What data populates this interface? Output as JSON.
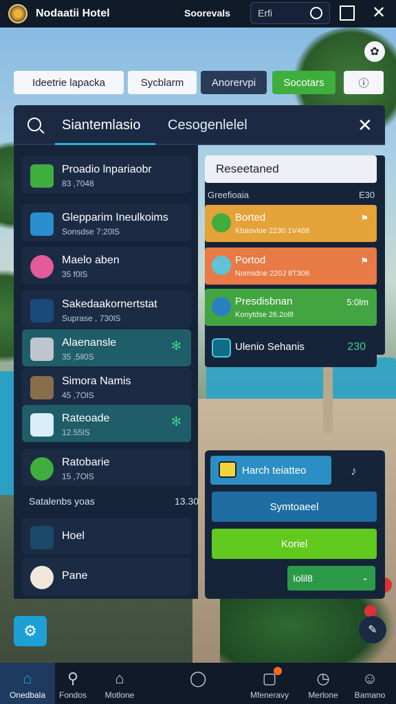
{
  "app": {
    "title": "Nodaatii Hotel",
    "top_link": "Soorevals",
    "search_value": "Erfi"
  },
  "chips": [
    "Ideetrie lapacka",
    "Sycblarm",
    "Anorervpi",
    "Socotars",
    "ⓘ"
  ],
  "panel": {
    "tab_1": "Siantemlasio",
    "tab_2": "Cesogenlelel"
  },
  "list": [
    {
      "title": "Proadio lnpariaobr",
      "sub": "83 ,7048"
    },
    {
      "title": "Glepparim Ineulkoims",
      "sub": "Sonsdse 7:20lS"
    },
    {
      "title": "Maelo aben",
      "sub": "35 f0lS"
    },
    {
      "title": "Sakedaakornertstat",
      "sub": "Suprase , 730lS"
    },
    {
      "title": "Alaenansle",
      "sub": "35 ,5ll0S"
    },
    {
      "title": "Simora Namis",
      "sub": "45 ,7OlS"
    },
    {
      "title": "Rateoade",
      "sub": "12.55lS"
    },
    {
      "title": "Ratobarie",
      "sub": "15 ,7OlS"
    },
    {
      "title": "Hoel",
      "sub": ""
    },
    {
      "title": "Pane",
      "sub": ""
    }
  ],
  "list_note": {
    "label": "Satalenbs yoas",
    "value": "13.30"
  },
  "right": {
    "search": "Reseetaned",
    "label": "Greefioaia",
    "label_value": "E30",
    "cards": [
      {
        "title": "Borted",
        "sub": "Kbaovloe 2230 1V488",
        "right": "⚑"
      },
      {
        "title": "Portod",
        "sub": "Nomsdne 220J 8T306",
        "right": "⚑"
      },
      {
        "title": "Presdisbnan",
        "sub": "Konytdse 26.2ol8",
        "right": "5:0lm"
      },
      {
        "title": "Ulenio Sehanis",
        "sub": "",
        "right": "230"
      }
    ]
  },
  "box": {
    "top": "Harch teiatteo",
    "arrow": "♪",
    "btn_1": "Symtoaeel",
    "btn_2": "Koriel",
    "select": "Iolil8"
  },
  "fab_icon": "settings-icon",
  "nav": [
    "Onedbala",
    "Fondos",
    "Motlone",
    "",
    "Mfeneravy",
    "Merlone",
    "Bamano"
  ],
  "colors": {
    "accent": "#1da0d6",
    "green": "#43a541",
    "orange": "#e87a45",
    "amber": "#e4a238"
  }
}
